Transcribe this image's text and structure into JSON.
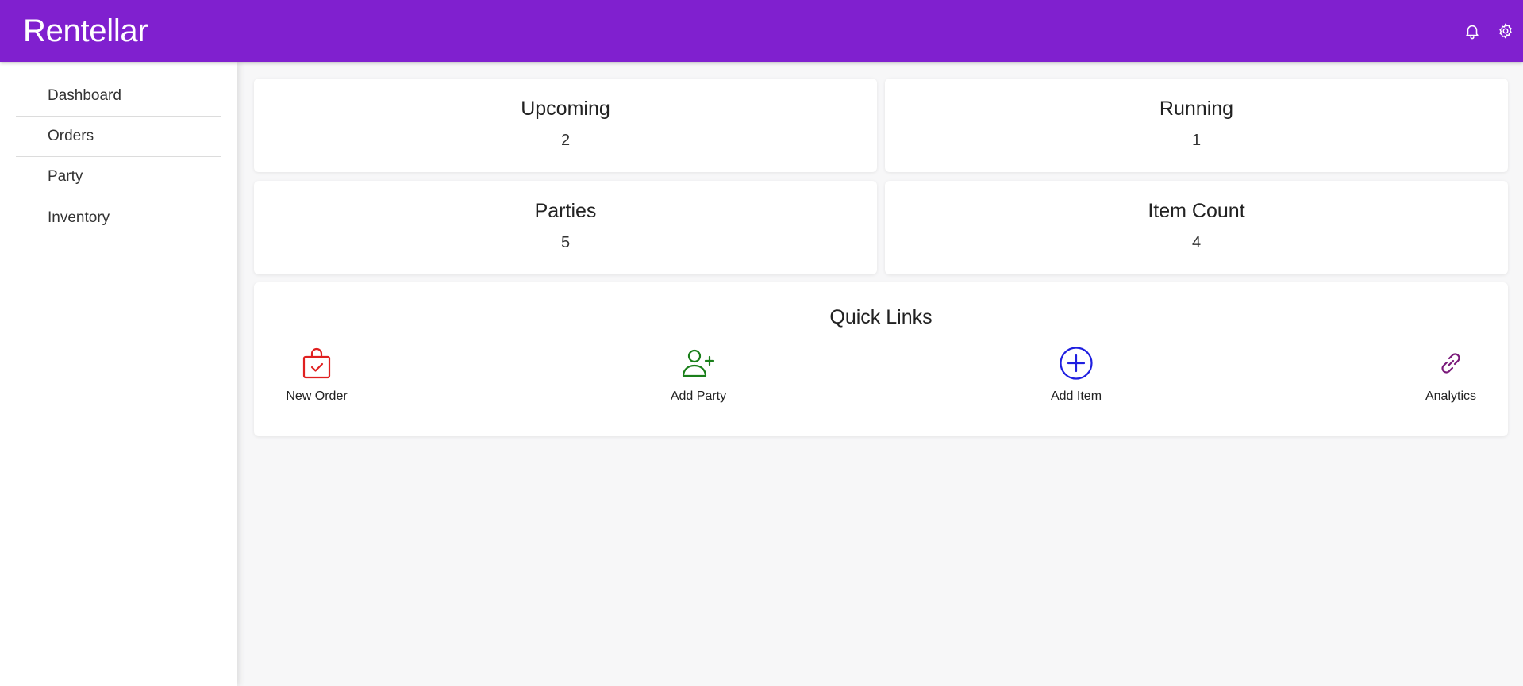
{
  "header": {
    "title": "Rentellar",
    "color": "#8020cf",
    "icons": [
      "bell-icon",
      "gear-icon"
    ]
  },
  "sidebar": {
    "items": [
      {
        "label": "Dashboard"
      },
      {
        "label": "Orders"
      },
      {
        "label": "Party"
      },
      {
        "label": "Inventory"
      }
    ]
  },
  "stats": [
    {
      "title": "Upcoming",
      "value": "2"
    },
    {
      "title": "Running",
      "value": "1"
    },
    {
      "title": "Parties",
      "value": "5"
    },
    {
      "title": "Item Count",
      "value": "4"
    }
  ],
  "quick_links": {
    "title": "Quick Links",
    "items": [
      {
        "label": "New Order",
        "icon": "shopping-bag-check-icon",
        "color": "#e02020"
      },
      {
        "label": "Add Party",
        "icon": "user-plus-icon",
        "color": "#1a7f1a"
      },
      {
        "label": "Add Item",
        "icon": "plus-circle-icon",
        "color": "#1f1fe0"
      },
      {
        "label": "Analytics",
        "icon": "link-icon",
        "color": "#7a1a7a"
      }
    ]
  }
}
